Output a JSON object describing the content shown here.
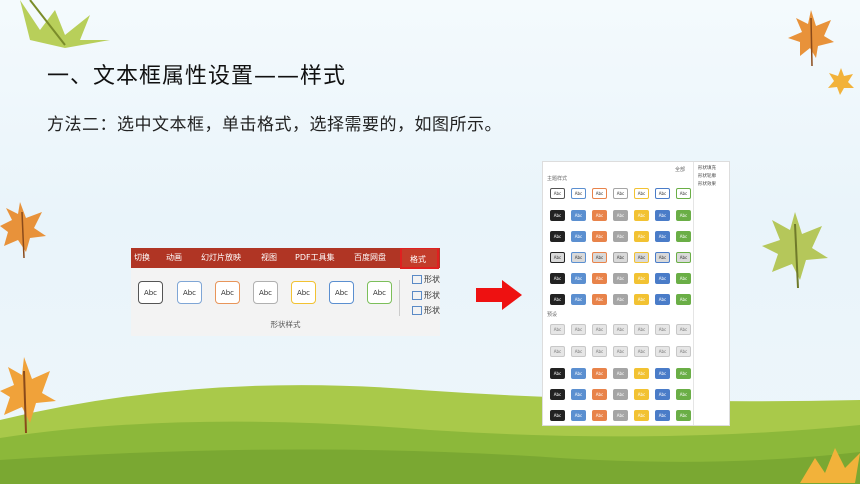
{
  "slide": {
    "title": "一、文本框属性设置——样式",
    "body": "方法二：选中文本框，单击格式，选择需要的，如图所示。"
  },
  "ribbon": {
    "tabs": [
      "切换",
      "动画",
      "幻灯片放映",
      "视图",
      "PDF工具集",
      "百度网盘"
    ],
    "active_tab": "格式",
    "style_label": "Abc",
    "side_buttons": [
      "形状",
      "形状",
      "形状"
    ],
    "group_label": "形状样式",
    "border_colors": [
      "#555555",
      "#7fa6d6",
      "#e8955a",
      "#b0b0b0",
      "#f2c232",
      "#5b8fd0",
      "#7cbf5a"
    ]
  },
  "gallery": {
    "top_label": "全部",
    "section1": "主题样式",
    "section2": "预设",
    "swatch_label": "Abc",
    "side_items": [
      "形状填充",
      "形状轮廓",
      "形状效果"
    ],
    "colors": [
      "#222222",
      "#5b8fd0",
      "#e8834a",
      "#a5a5a5",
      "#f2c232",
      "#4a7cc8",
      "#6aae46"
    ]
  },
  "colors": {
    "tab_red": "#b03524",
    "highlight_red": "#e02020",
    "arrow_red": "#ee1111",
    "hill_green": "#8cb83a"
  }
}
